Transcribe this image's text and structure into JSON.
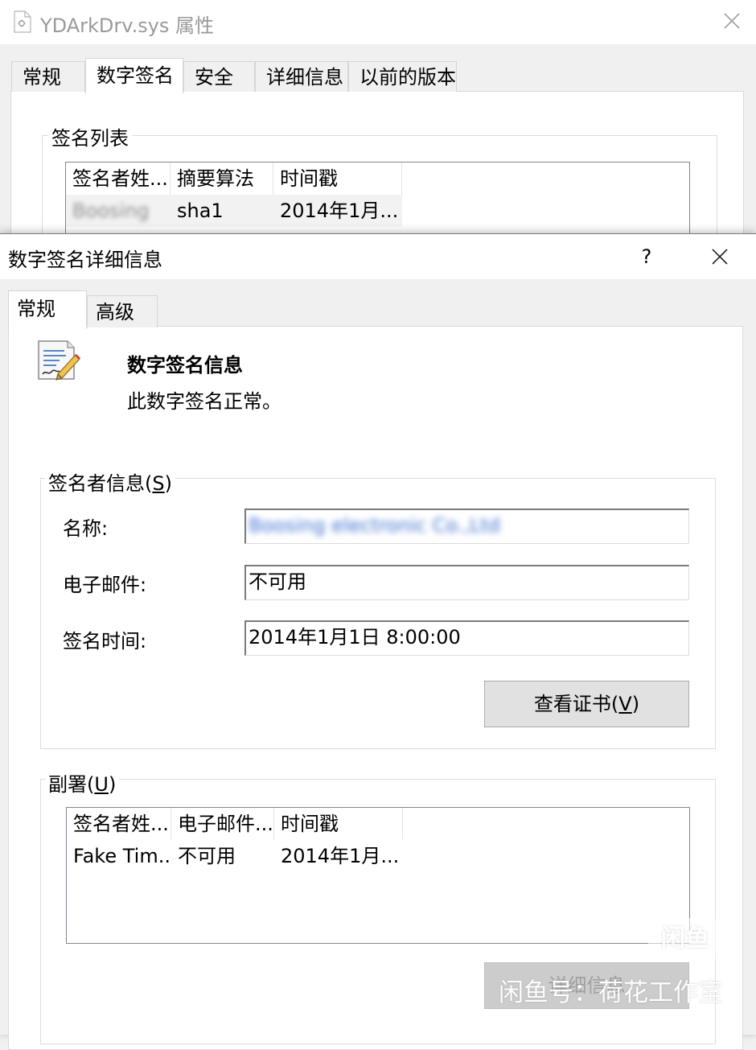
{
  "back_window": {
    "title": "YDArkDrv.sys 属性",
    "tabs": [
      {
        "label": "常规",
        "active": false
      },
      {
        "label": "数字签名",
        "active": true
      },
      {
        "label": "安全",
        "active": false
      },
      {
        "label": "详细信息",
        "active": false
      },
      {
        "label": "以前的版本",
        "active": false
      }
    ],
    "signature_list_label": "签名列表",
    "signature_list": {
      "columns": [
        "签名者姓...",
        "摘要算法",
        "时间戳"
      ],
      "rows": [
        {
          "signer": "Boosing",
          "digest": "sha1",
          "timestamp": "2014年1月..."
        }
      ]
    }
  },
  "dialog": {
    "title": "数字签名详细信息",
    "help_label": "?",
    "tabs": [
      {
        "label": "常规",
        "active": true
      },
      {
        "label": "高级",
        "active": false
      }
    ],
    "heading": "数字签名信息",
    "status": "此数字签名正常。",
    "signer_group": {
      "label_text": "签名者信息(",
      "label_key": "S",
      "label_end": ")",
      "name_label": "名称:",
      "name_value": "Boosing electronic Co.,Ltd",
      "email_label": "电子邮件:",
      "email_value": "不可用",
      "time_label": "签名时间:",
      "time_value": "2014年1月1日 8:00:00",
      "view_cert_text": "查看证书(",
      "view_cert_key": "V",
      "view_cert_end": ")"
    },
    "countersignature_group": {
      "label_text": "副署(",
      "label_key": "U",
      "label_end": ")",
      "columns": [
        "签名者姓...",
        "电子邮件...",
        "时间戳"
      ],
      "rows": [
        {
          "signer": "Fake Tim...",
          "email": "不可用",
          "timestamp": "2014年1月..."
        }
      ],
      "details_button": "详细信息"
    }
  },
  "watermark": {
    "logo": "闲鱼",
    "text": "闲鱼号：荷花工作室"
  },
  "colors": {
    "window_bg": "#f0f0f0",
    "page_bg": "#ffffff",
    "button_bg": "#e1e1e1",
    "button_border": "#adadad",
    "list_border": "#828790",
    "row_highlight": "#f2f2f2"
  },
  "icons": {
    "back_window": "file-icon",
    "close": "close-icon",
    "signature": "certificate-pen-icon"
  }
}
